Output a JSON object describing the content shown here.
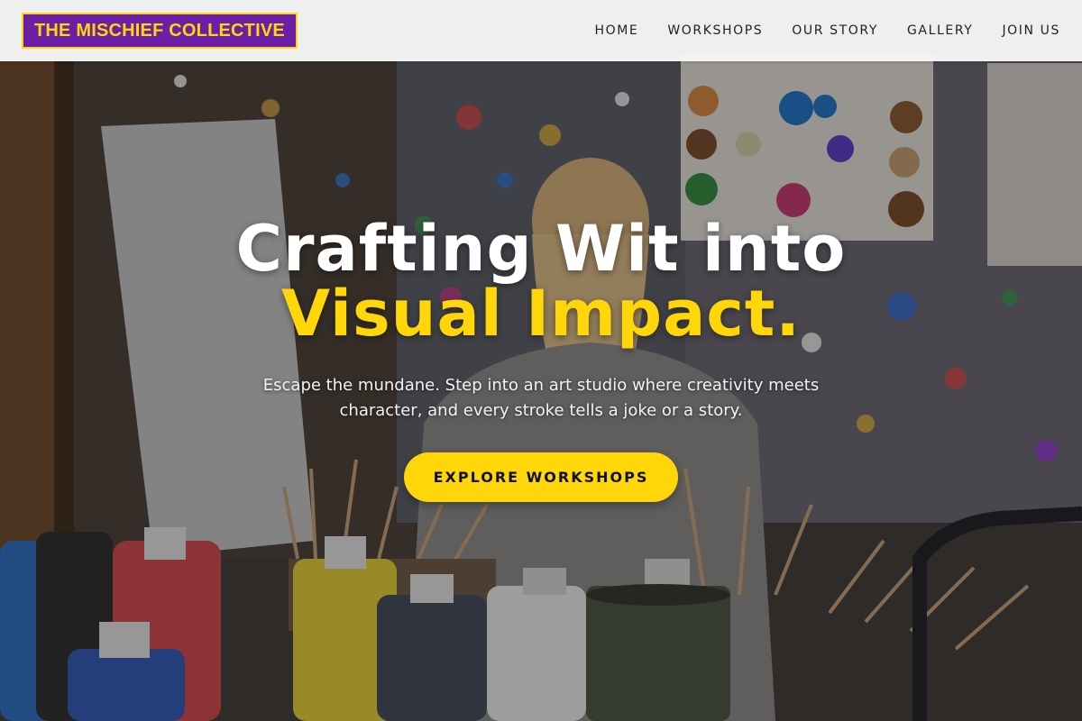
{
  "brand": {
    "name": "THE MISCHIEF COLLECTIVE"
  },
  "nav": {
    "items": [
      {
        "label": "HOME"
      },
      {
        "label": "WORKSHOPS"
      },
      {
        "label": "OUR STORY"
      },
      {
        "label": "GALLERY"
      },
      {
        "label": "JOIN US"
      }
    ]
  },
  "hero": {
    "headline_line1": "Crafting Wit into",
    "headline_line2": "Visual Impact.",
    "subtext": "Escape the mundane. Step into an art studio where creativity meets character, and every stroke tells a joke or a story.",
    "cta_label": "EXPLORE WORKSHOPS",
    "background_image": "art-studio-photo"
  },
  "colors": {
    "accent": "#ffd60a",
    "brand": "#6a1fa6",
    "nav_bg": "#f8f8f8"
  }
}
